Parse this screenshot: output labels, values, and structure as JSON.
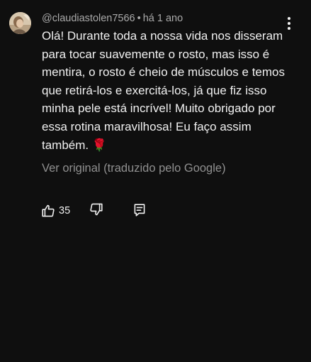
{
  "comment": {
    "author": "@claudiastolen7566",
    "separator": "•",
    "timestamp": "há 1 ano",
    "text": "Olá! Durante toda a nossa vida nos disseram\npara tocar suavemente o rosto, mas isso é\nmentira, o rosto é cheio de músculos e temos\nque retirá-los e exercitá-los, já que fiz isso\nminha pele está incrível! Muito obrigado por\nessa rotina maravilhosa! Eu faço assim\ntambém. 🌹",
    "translation_link": "Ver original (traduzido pelo Google)",
    "like_count": "35"
  },
  "icons": {
    "avatar": "avatar-image",
    "more": "more-vertical-icon",
    "like": "thumb-up-icon",
    "dislike": "thumb-down-icon",
    "reply": "reply-comment-icon"
  },
  "colors": {
    "background": "#0f0f0f",
    "primary_text": "#f1f1f1",
    "secondary_text": "#aaaaaa",
    "link_text": "#909090"
  }
}
